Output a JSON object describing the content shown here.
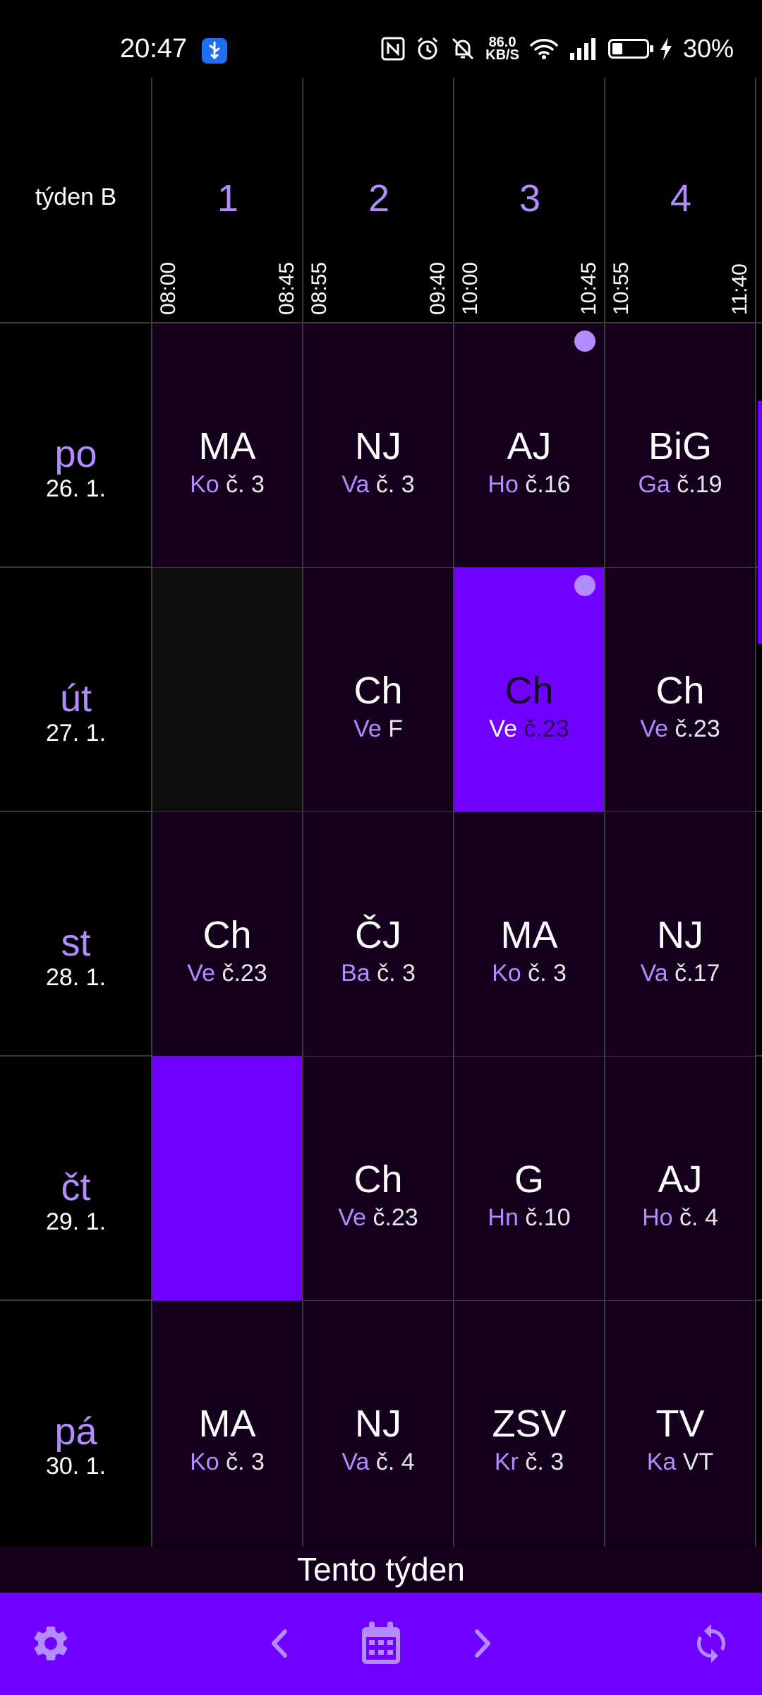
{
  "status_bar": {
    "time": "20:47",
    "net_speed_value": "86.0",
    "net_speed_unit": "KB/S",
    "battery_percent": "30%",
    "battery_level": 0.3
  },
  "header": {
    "week_label": "týden B",
    "periods": [
      {
        "num": "1",
        "start": "08:00",
        "end": "08:45"
      },
      {
        "num": "2",
        "start": "08:55",
        "end": "09:40"
      },
      {
        "num": "3",
        "start": "10:00",
        "end": "10:45"
      },
      {
        "num": "4",
        "start": "10:55",
        "end": "11:40"
      }
    ]
  },
  "days": [
    {
      "name": "po",
      "date": "26. 1.",
      "lessons": [
        {
          "subject": "MA",
          "teacher": "Ko",
          "room": "č. 3"
        },
        {
          "subject": "NJ",
          "teacher": "Va",
          "room": "č. 3"
        },
        {
          "subject": "AJ",
          "teacher": "Ho",
          "room": "č.16"
        },
        {
          "subject": "BiG",
          "teacher": "Ga",
          "room": "č.19"
        }
      ]
    },
    {
      "name": "út",
      "date": "27. 1.",
      "lessons": [
        {
          "subject": "",
          "teacher": "",
          "room": ""
        },
        {
          "subject": "Ch",
          "teacher": "Ve",
          "room": "F"
        },
        {
          "subject": "Ch",
          "teacher": "Ve",
          "room": "č.23"
        },
        {
          "subject": "Ch",
          "teacher": "Ve",
          "room": "č.23"
        }
      ]
    },
    {
      "name": "st",
      "date": "28. 1.",
      "lessons": [
        {
          "subject": "Ch",
          "teacher": "Ve",
          "room": "č.23"
        },
        {
          "subject": "ČJ",
          "teacher": "Ba",
          "room": "č. 3"
        },
        {
          "subject": "MA",
          "teacher": "Ko",
          "room": "č. 3"
        },
        {
          "subject": "NJ",
          "teacher": "Va",
          "room": "č.17"
        }
      ]
    },
    {
      "name": "čt",
      "date": "29. 1.",
      "lessons": [
        {
          "subject": "",
          "teacher": "",
          "room": ""
        },
        {
          "subject": "Ch",
          "teacher": "Ve",
          "room": "č.23"
        },
        {
          "subject": "G",
          "teacher": "Hn",
          "room": "č.10"
        },
        {
          "subject": "AJ",
          "teacher": "Ho",
          "room": "č. 4"
        }
      ]
    },
    {
      "name": "pá",
      "date": "30. 1.",
      "lessons": [
        {
          "subject": "MA",
          "teacher": "Ko",
          "room": "č. 3"
        },
        {
          "subject": "NJ",
          "teacher": "Va",
          "room": "č. 4"
        },
        {
          "subject": "ZSV",
          "teacher": "Kr",
          "room": "č. 3"
        },
        {
          "subject": "TV",
          "teacher": "Ka",
          "room": "VT"
        }
      ]
    }
  ],
  "footer": {
    "week_title": "Tento týden"
  },
  "colors": {
    "accent": "#7000ff",
    "accent_light": "#b38cff",
    "cell_bg": "#14001c",
    "empty_cell_bg": "#0e0e0e",
    "background": "#000000"
  },
  "icons": {
    "settings": "gear-icon",
    "prev": "chevron-left-icon",
    "calendar": "calendar-icon",
    "next": "chevron-right-icon",
    "refresh": "refresh-icon"
  }
}
